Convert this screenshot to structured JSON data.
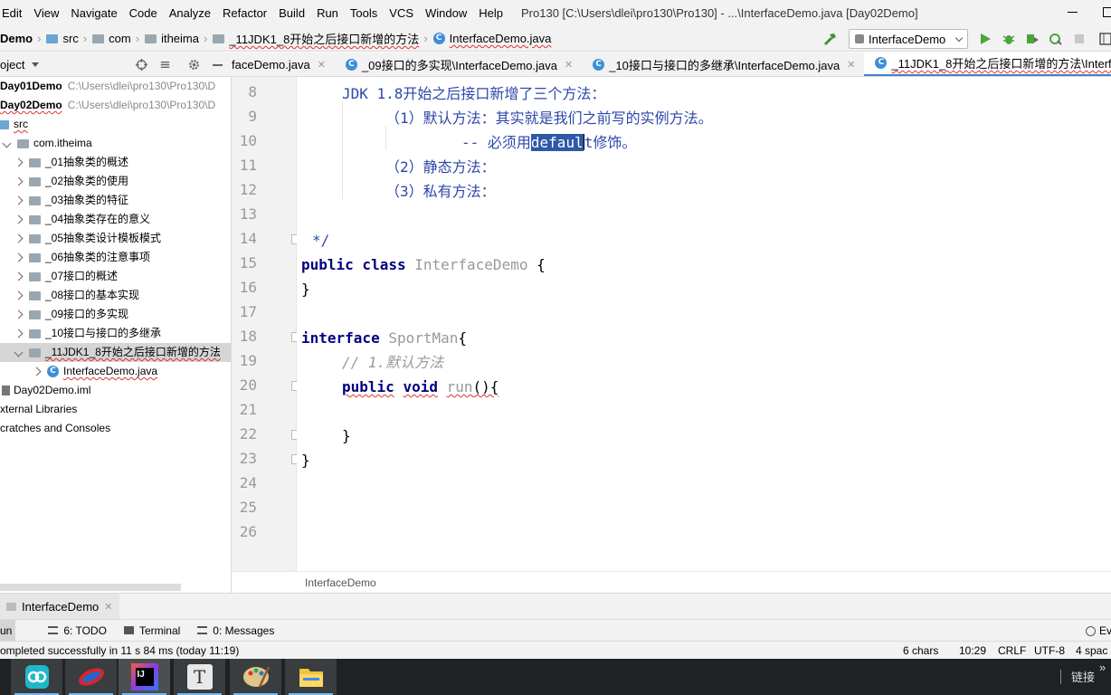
{
  "menu": [
    "Edit",
    "View",
    "Navigate",
    "Code",
    "Analyze",
    "Refactor",
    "Build",
    "Run",
    "Tools",
    "VCS",
    "Window",
    "Help"
  ],
  "window_title": "Pro130 [C:\\Users\\dlei\\pro130\\Pro130] - ...\\InterfaceDemo.java [Day02Demo]",
  "breadcrumbs": [
    "Demo",
    "src",
    "com",
    "itheima",
    "_11JDK1_8开始之后接口新增的方法",
    "InterfaceDemo.java"
  ],
  "run_config": "InterfaceDemo",
  "project_header": "oject",
  "tabs": [
    {
      "label": "faceDemo.java",
      "active": false
    },
    {
      "label": "_09接口的多实现\\InterfaceDemo.java",
      "active": false
    },
    {
      "label": "_10接口与接口的多继承\\InterfaceDemo.java",
      "active": false
    },
    {
      "label": "_11JDK1_8开始之后接口新增的方法\\InterfaceDemo.ja",
      "active": true
    }
  ],
  "tree": [
    {
      "label": "Day01Demo",
      "path": "C:\\Users\\dlei\\pro130\\Pro130\\D",
      "bold": true
    },
    {
      "label": "Day02Demo",
      "path": "C:\\Users\\dlei\\pro130\\Pro130\\D",
      "bold": true
    },
    {
      "label": "src"
    },
    {
      "label": "com.itheima"
    },
    {
      "label": "_01抽象类的概述"
    },
    {
      "label": "_02抽象类的使用"
    },
    {
      "label": "_03抽象类的特征"
    },
    {
      "label": "_04抽象类存在的意义"
    },
    {
      "label": "_05抽象类设计模板模式"
    },
    {
      "label": "_06抽象类的注意事项"
    },
    {
      "label": "_07接口的概述"
    },
    {
      "label": "_08接口的基本实现"
    },
    {
      "label": "_09接口的多实现"
    },
    {
      "label": "_10接口与接口的多继承"
    },
    {
      "label": "_11JDK1_8开始之后接口新增的方法"
    },
    {
      "label": "InterfaceDemo.java"
    },
    {
      "label": "Day02Demo.iml"
    },
    {
      "label": "xternal Libraries"
    },
    {
      "label": "cratches and Consoles"
    }
  ],
  "line_numbers": [
    "8",
    "9",
    "10",
    "11",
    "12",
    "13",
    "14",
    "15",
    "16",
    "17",
    "18",
    "19",
    "20",
    "21",
    "22",
    "23",
    "24",
    "25",
    "26"
  ],
  "code": {
    "l8": "JDK 1.8开始之后接口新增了三个方法：",
    "l9": "（1）默认方法：其实就是我们之前写的实例方法。",
    "l10_a": "-- 必须用",
    "l10_sel": "defaul",
    "l10_b": "t修饰。",
    "l11": "（2）静态方法：",
    "l12": "（3）私有方法：",
    "l14": "*/",
    "l15_kw": "public class",
    "l15_name": "InterfaceDemo",
    "l15_brace": "{",
    "l16": "}",
    "l18_kw": "interface",
    "l18_name": "SportMan",
    "l18_brace": "{",
    "l19": "// 1.默认方法",
    "l20_kw1": "public",
    "l20_kw2": "void",
    "l20_name": "run",
    "l20_rest": "(){",
    "l22": "}",
    "l23": "}"
  },
  "editor_breadcrumb": "InterfaceDemo",
  "run_tab": "InterfaceDemo",
  "tool_windows": {
    "run": "un",
    "todo": "6: TODO",
    "terminal": "Terminal",
    "messages": "0: Messages",
    "event": "Ev"
  },
  "status": {
    "message": "ompleted successfully in 11 s 84 ms (today 11:19)",
    "chars": "6 chars",
    "position": "10:29",
    "line_sep": "CRLF",
    "encoding": "UTF-8",
    "indent": "4 spac"
  },
  "taskbar": {
    "tray_label": "链接",
    "tray_chevron": "»",
    "intellij_label": "IJ",
    "typora_label": "T"
  },
  "colors": {
    "accent": "#4083c9",
    "selection": "#2d59a6",
    "comment": "#2d47a8",
    "keyword": "#000080"
  }
}
